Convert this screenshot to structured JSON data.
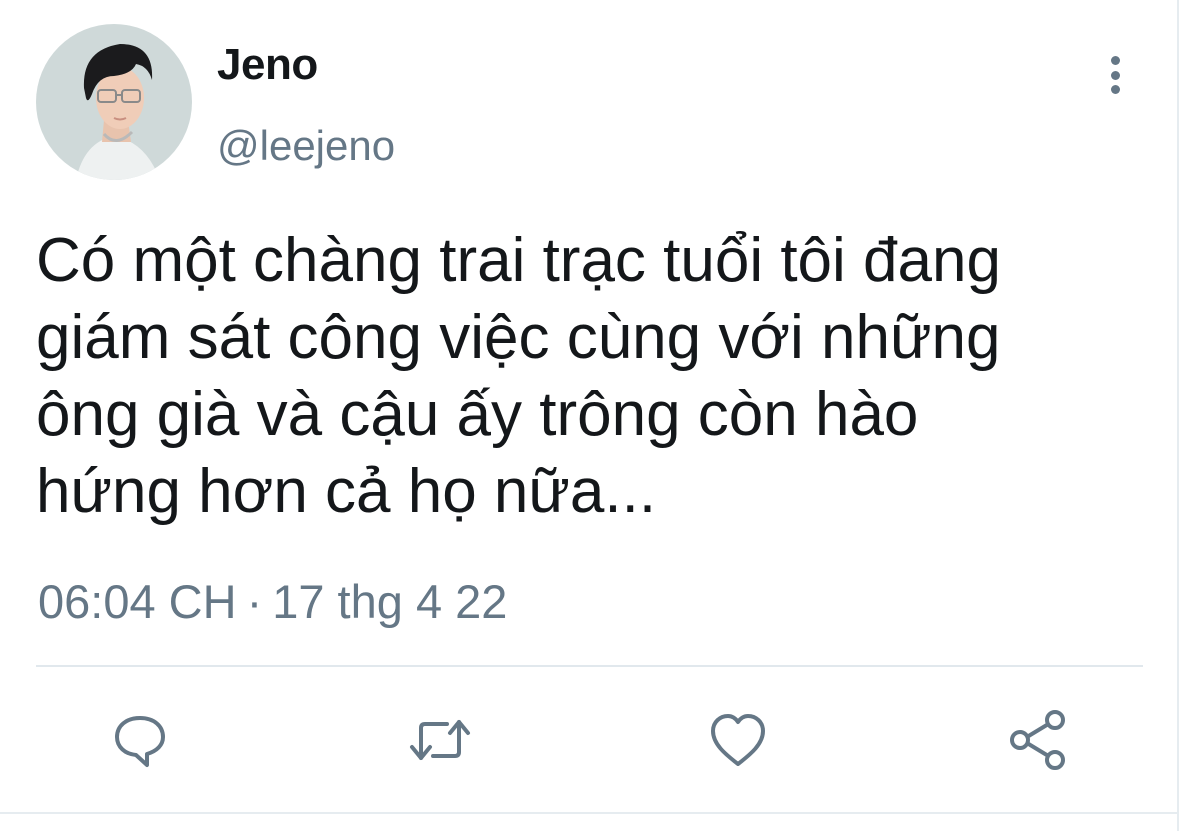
{
  "tweet": {
    "author": {
      "display_name": "Jeno",
      "handle": "@leejeno",
      "avatar_alt": "avatar"
    },
    "text": "Có một chàng trai trạc tuổi tôi đang\ngiám sát công việc cùng với những\nông già và cậu ấy trông còn hào\nhứng hơn cả họ nữa...",
    "time": "06:04 CH",
    "separator": "·",
    "date": "17 thg 4 22"
  },
  "actions": [
    {
      "name": "reply",
      "icon": "speech-bubble-icon"
    },
    {
      "name": "retweet",
      "icon": "retweet-arrows-icon"
    },
    {
      "name": "like",
      "icon": "heart-icon"
    },
    {
      "name": "share",
      "icon": "share-nodes-icon"
    }
  ],
  "colors": {
    "text_primary": "#14171a",
    "text_secondary": "#657786",
    "divider": "#e1e8ed"
  }
}
